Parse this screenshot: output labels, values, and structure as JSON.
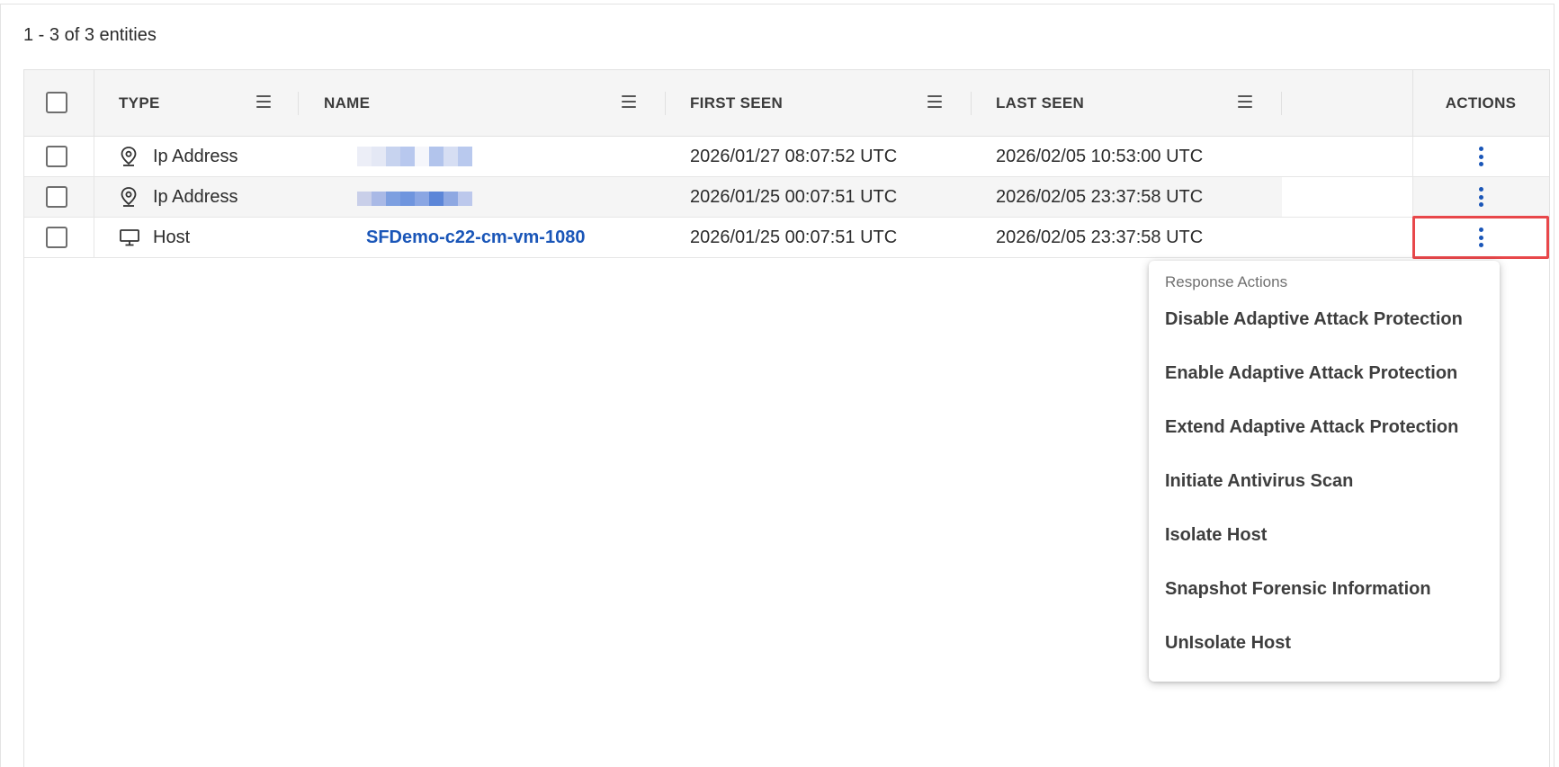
{
  "summary": "1 - 3 of 3 entities",
  "columns": {
    "type": "TYPE",
    "name": "NAME",
    "first_seen": "FIRST SEEN",
    "last_seen": "LAST SEEN",
    "actions": "ACTIONS"
  },
  "rows": [
    {
      "type": "Ip Address",
      "icon": "location-pin-icon",
      "name": "",
      "first_seen": "2026/01/27 08:07:52 UTC",
      "last_seen": "2026/02/05 10:53:00 UTC"
    },
    {
      "type": "Ip Address",
      "icon": "location-pin-icon",
      "name": "",
      "first_seen": "2026/01/25 00:07:51 UTC",
      "last_seen": "2026/02/05 23:37:58 UTC"
    },
    {
      "type": "Host",
      "icon": "monitor-icon",
      "name": "SFDemo-c22-cm-vm-1080",
      "first_seen": "2026/01/25 00:07:51 UTC",
      "last_seen": "2026/02/05 23:37:58 UTC"
    }
  ],
  "dropdown": {
    "title": "Response Actions",
    "items": [
      "Disable Adaptive Attack Protection",
      "Enable Adaptive Attack Protection",
      "Extend Adaptive Attack Protection",
      "Initiate Antivirus Scan",
      "Isolate Host",
      "Snapshot Forensic Information",
      "UnIsolate Host"
    ]
  },
  "colors": {
    "link": "#1a56b8",
    "highlight": "#e8474a",
    "header_bg": "#f5f5f5"
  }
}
